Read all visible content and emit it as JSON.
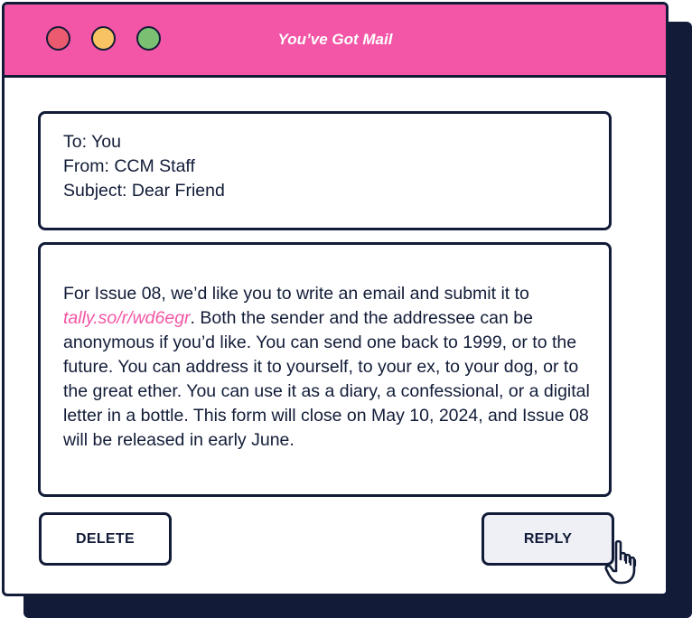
{
  "window": {
    "title": "You’ve Got Mail",
    "colors": {
      "titlebar": "#f356a6",
      "outline": "#121c38",
      "dot_red": "#ec5a70",
      "dot_yellow": "#f8c363",
      "dot_green": "#7bc072",
      "link": "#f356a6"
    }
  },
  "email": {
    "to": "To: You",
    "from": "From: CCM Staff",
    "subject": "Subject: Dear Friend",
    "body_before_link": "For Issue 08, we’d like you to write an email and submit it to ",
    "link_text": "tally.so/r/wd6egr",
    "body_after_link": ". Both the sender and the addressee can be anonymous if you’d like. You can send one back to 1999, or to the future. You can address it to yourself, to your ex, to your dog, or to the great ether. You can use it as a diary, a confessional, or a digital letter in a bottle. This form will close on May 10, 2024, and Issue 08 will be released in early June."
  },
  "buttons": {
    "delete_label": "DELETE",
    "reply_label": "REPLY"
  },
  "icons": {
    "cursor": "hand-pointer-icon"
  }
}
